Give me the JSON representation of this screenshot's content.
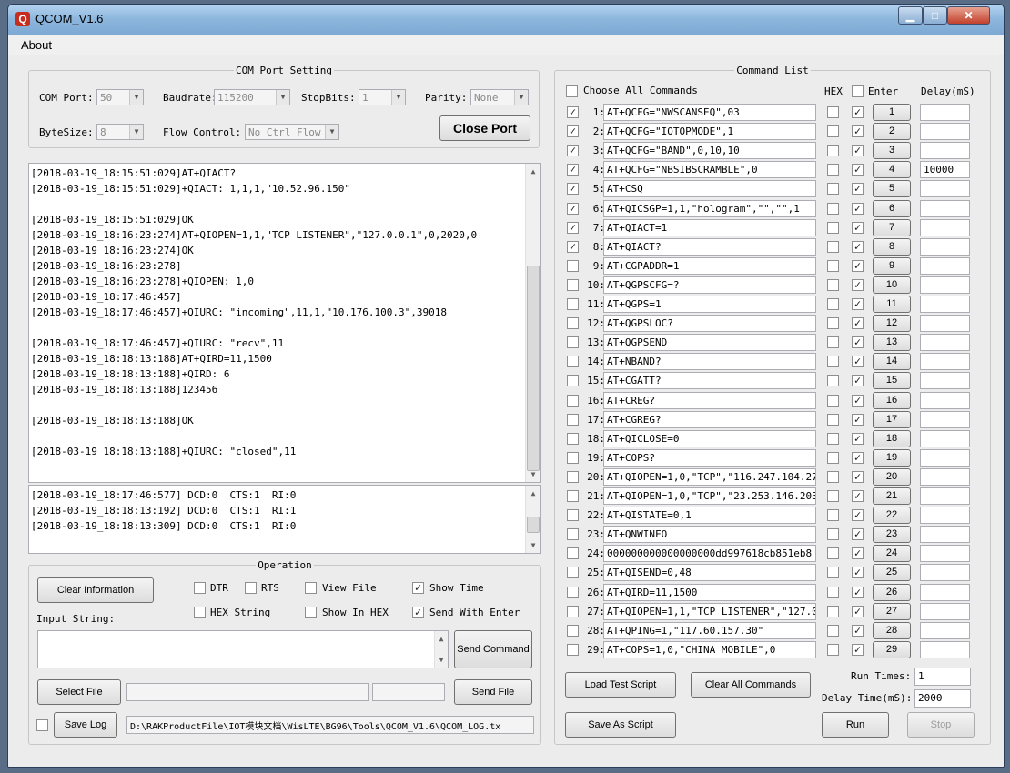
{
  "window": {
    "title": "QCOM_V1.6"
  },
  "menu": {
    "about": "About"
  },
  "com_port": {
    "legend": "COM Port Setting",
    "port_label": "COM Port:",
    "port_value": "50",
    "baud_label": "Baudrate:",
    "baud_value": "115200",
    "stopbits_label": "StopBits:",
    "stopbits_value": "1",
    "parity_label": "Parity:",
    "parity_value": "None",
    "bytesize_label": "ByteSize:",
    "bytesize_value": "8",
    "flow_label": "Flow Control:",
    "flow_value": "No Ctrl Flow",
    "close_port_label": "Close Port"
  },
  "log": {
    "lines": [
      "[2018-03-19_18:15:51:029]AT+QIACT?",
      "[2018-03-19_18:15:51:029]+QIACT: 1,1,1,\"10.52.96.150\"",
      "",
      "[2018-03-19_18:15:51:029]OK",
      "[2018-03-19_18:16:23:274]AT+QIOPEN=1,1,\"TCP LISTENER\",\"127.0.0.1\",0,2020,0",
      "[2018-03-19_18:16:23:274]OK",
      "[2018-03-19_18:16:23:278]",
      "[2018-03-19_18:16:23:278]+QIOPEN: 1,0",
      "[2018-03-19_18:17:46:457]",
      "[2018-03-19_18:17:46:457]+QIURC: \"incoming\",11,1,\"10.176.100.3\",39018",
      "",
      "[2018-03-19_18:17:46:457]+QIURC: \"recv\",11",
      "[2018-03-19_18:18:13:188]AT+QIRD=11,1500",
      "[2018-03-19_18:18:13:188]+QIRD: 6",
      "[2018-03-19_18:18:13:188]123456",
      "",
      "[2018-03-19_18:18:13:188]OK",
      "",
      "[2018-03-19_18:18:13:188]+QIURC: \"closed\",11"
    ]
  },
  "status_log": {
    "lines": [
      "[2018-03-19_18:17:46:577] DCD:0  CTS:1  RI:0",
      "[2018-03-19_18:18:13:192] DCD:0  CTS:1  RI:1",
      "[2018-03-19_18:18:13:309] DCD:0  CTS:1  RI:0"
    ]
  },
  "operation": {
    "legend": "Operation",
    "clear_info_label": "Clear Information",
    "dtr_label": "DTR",
    "rts_label": "RTS",
    "view_file_label": "View File",
    "show_time_label": "Show Time",
    "hex_string_label": "HEX String",
    "show_in_hex_label": "Show In HEX",
    "send_with_enter_label": "Send With Enter",
    "input_string_label": "Input String:",
    "send_command_label": "Send Command",
    "select_file_label": "Select File",
    "send_file_label": "Send File",
    "save_log_label": "Save Log",
    "log_path": "D:\\RAKProductFile\\IOT模块文档\\WisLTE\\BG96\\Tools\\QCOM_V1.6\\QCOM_LOG.tx"
  },
  "command_list": {
    "legend": "Command List",
    "choose_all_label": "Choose All Commands",
    "hex_header": "HEX",
    "enter_header": "Enter",
    "delay_header": "Delay(mS)",
    "rows": [
      {
        "num": "1:",
        "cmd": "AT+QCFG=\"NWSCANSEQ\",03",
        "sel": true,
        "hex": false,
        "enter": true,
        "idx": "1",
        "delay": ""
      },
      {
        "num": "2:",
        "cmd": "AT+QCFG=\"IOTOPMODE\",1",
        "sel": true,
        "hex": false,
        "enter": true,
        "idx": "2",
        "delay": ""
      },
      {
        "num": "3:",
        "cmd": "AT+QCFG=\"BAND\",0,10,10",
        "sel": true,
        "hex": false,
        "enter": true,
        "idx": "3",
        "delay": ""
      },
      {
        "num": "4:",
        "cmd": "AT+QCFG=\"NBSIBSCRAMBLE\",0",
        "sel": true,
        "hex": false,
        "enter": true,
        "idx": "4",
        "delay": "10000"
      },
      {
        "num": "5:",
        "cmd": "AT+CSQ",
        "sel": true,
        "hex": false,
        "enter": true,
        "idx": "5",
        "delay": ""
      },
      {
        "num": "6:",
        "cmd": "AT+QICSGP=1,1,\"hologram\",\"\",\"\",1",
        "sel": true,
        "hex": false,
        "enter": true,
        "idx": "6",
        "delay": ""
      },
      {
        "num": "7:",
        "cmd": "AT+QIACT=1",
        "sel": true,
        "hex": false,
        "enter": true,
        "idx": "7",
        "delay": ""
      },
      {
        "num": "8:",
        "cmd": "AT+QIACT?",
        "sel": true,
        "hex": false,
        "enter": true,
        "idx": "8",
        "delay": ""
      },
      {
        "num": "9:",
        "cmd": "AT+CGPADDR=1",
        "sel": false,
        "hex": false,
        "enter": true,
        "idx": "9",
        "delay": ""
      },
      {
        "num": "10:",
        "cmd": "AT+QGPSCFG=?",
        "sel": false,
        "hex": false,
        "enter": true,
        "idx": "10",
        "delay": ""
      },
      {
        "num": "11:",
        "cmd": "AT+QGPS=1",
        "sel": false,
        "hex": false,
        "enter": true,
        "idx": "11",
        "delay": ""
      },
      {
        "num": "12:",
        "cmd": "AT+QGPSLOC?",
        "sel": false,
        "hex": false,
        "enter": true,
        "idx": "12",
        "delay": ""
      },
      {
        "num": "13:",
        "cmd": "AT+QGPSEND",
        "sel": false,
        "hex": false,
        "enter": true,
        "idx": "13",
        "delay": ""
      },
      {
        "num": "14:",
        "cmd": "AT+NBAND?",
        "sel": false,
        "hex": false,
        "enter": true,
        "idx": "14",
        "delay": ""
      },
      {
        "num": "15:",
        "cmd": "AT+CGATT?",
        "sel": false,
        "hex": false,
        "enter": true,
        "idx": "15",
        "delay": ""
      },
      {
        "num": "16:",
        "cmd": "AT+CREG?",
        "sel": false,
        "hex": false,
        "enter": true,
        "idx": "16",
        "delay": ""
      },
      {
        "num": "17:",
        "cmd": "AT+CGREG?",
        "sel": false,
        "hex": false,
        "enter": true,
        "idx": "17",
        "delay": ""
      },
      {
        "num": "18:",
        "cmd": "AT+QICLOSE=0",
        "sel": false,
        "hex": false,
        "enter": true,
        "idx": "18",
        "delay": ""
      },
      {
        "num": "19:",
        "cmd": "AT+COPS?",
        "sel": false,
        "hex": false,
        "enter": true,
        "idx": "19",
        "delay": ""
      },
      {
        "num": "20:",
        "cmd": "AT+QIOPEN=1,0,\"TCP\",\"116.247.104.27",
        "sel": false,
        "hex": false,
        "enter": true,
        "idx": "20",
        "delay": ""
      },
      {
        "num": "21:",
        "cmd": "AT+QIOPEN=1,0,\"TCP\",\"23.253.146.203",
        "sel": false,
        "hex": false,
        "enter": true,
        "idx": "21",
        "delay": ""
      },
      {
        "num": "22:",
        "cmd": "AT+QISTATE=0,1",
        "sel": false,
        "hex": false,
        "enter": true,
        "idx": "22",
        "delay": ""
      },
      {
        "num": "23:",
        "cmd": "AT+QNWINFO",
        "sel": false,
        "hex": false,
        "enter": true,
        "idx": "23",
        "delay": ""
      },
      {
        "num": "24:",
        "cmd": "000000000000000000dd997618cb851eb8",
        "sel": false,
        "hex": false,
        "enter": true,
        "idx": "24",
        "delay": ""
      },
      {
        "num": "25:",
        "cmd": "AT+QISEND=0,48",
        "sel": false,
        "hex": false,
        "enter": true,
        "idx": "25",
        "delay": ""
      },
      {
        "num": "26:",
        "cmd": "AT+QIRD=11,1500",
        "sel": false,
        "hex": false,
        "enter": true,
        "idx": "26",
        "delay": ""
      },
      {
        "num": "27:",
        "cmd": "AT+QIOPEN=1,1,\"TCP LISTENER\",\"127.0.",
        "sel": false,
        "hex": false,
        "enter": true,
        "idx": "27",
        "delay": ""
      },
      {
        "num": "28:",
        "cmd": "AT+QPING=1,\"117.60.157.30\"",
        "sel": false,
        "hex": false,
        "enter": true,
        "idx": "28",
        "delay": ""
      },
      {
        "num": "29:",
        "cmd": "AT+COPS=1,0,\"CHINA MOBILE\",0",
        "sel": false,
        "hex": false,
        "enter": true,
        "idx": "29",
        "delay": ""
      }
    ],
    "load_script_label": "Load Test Script",
    "clear_all_label": "Clear All Commands",
    "run_times_label": "Run Times:",
    "run_times_value": "1",
    "delay_time_label": "Delay Time(mS):",
    "delay_time_value": "2000",
    "save_script_label": "Save As Script",
    "run_label": "Run",
    "stop_label": "Stop"
  }
}
